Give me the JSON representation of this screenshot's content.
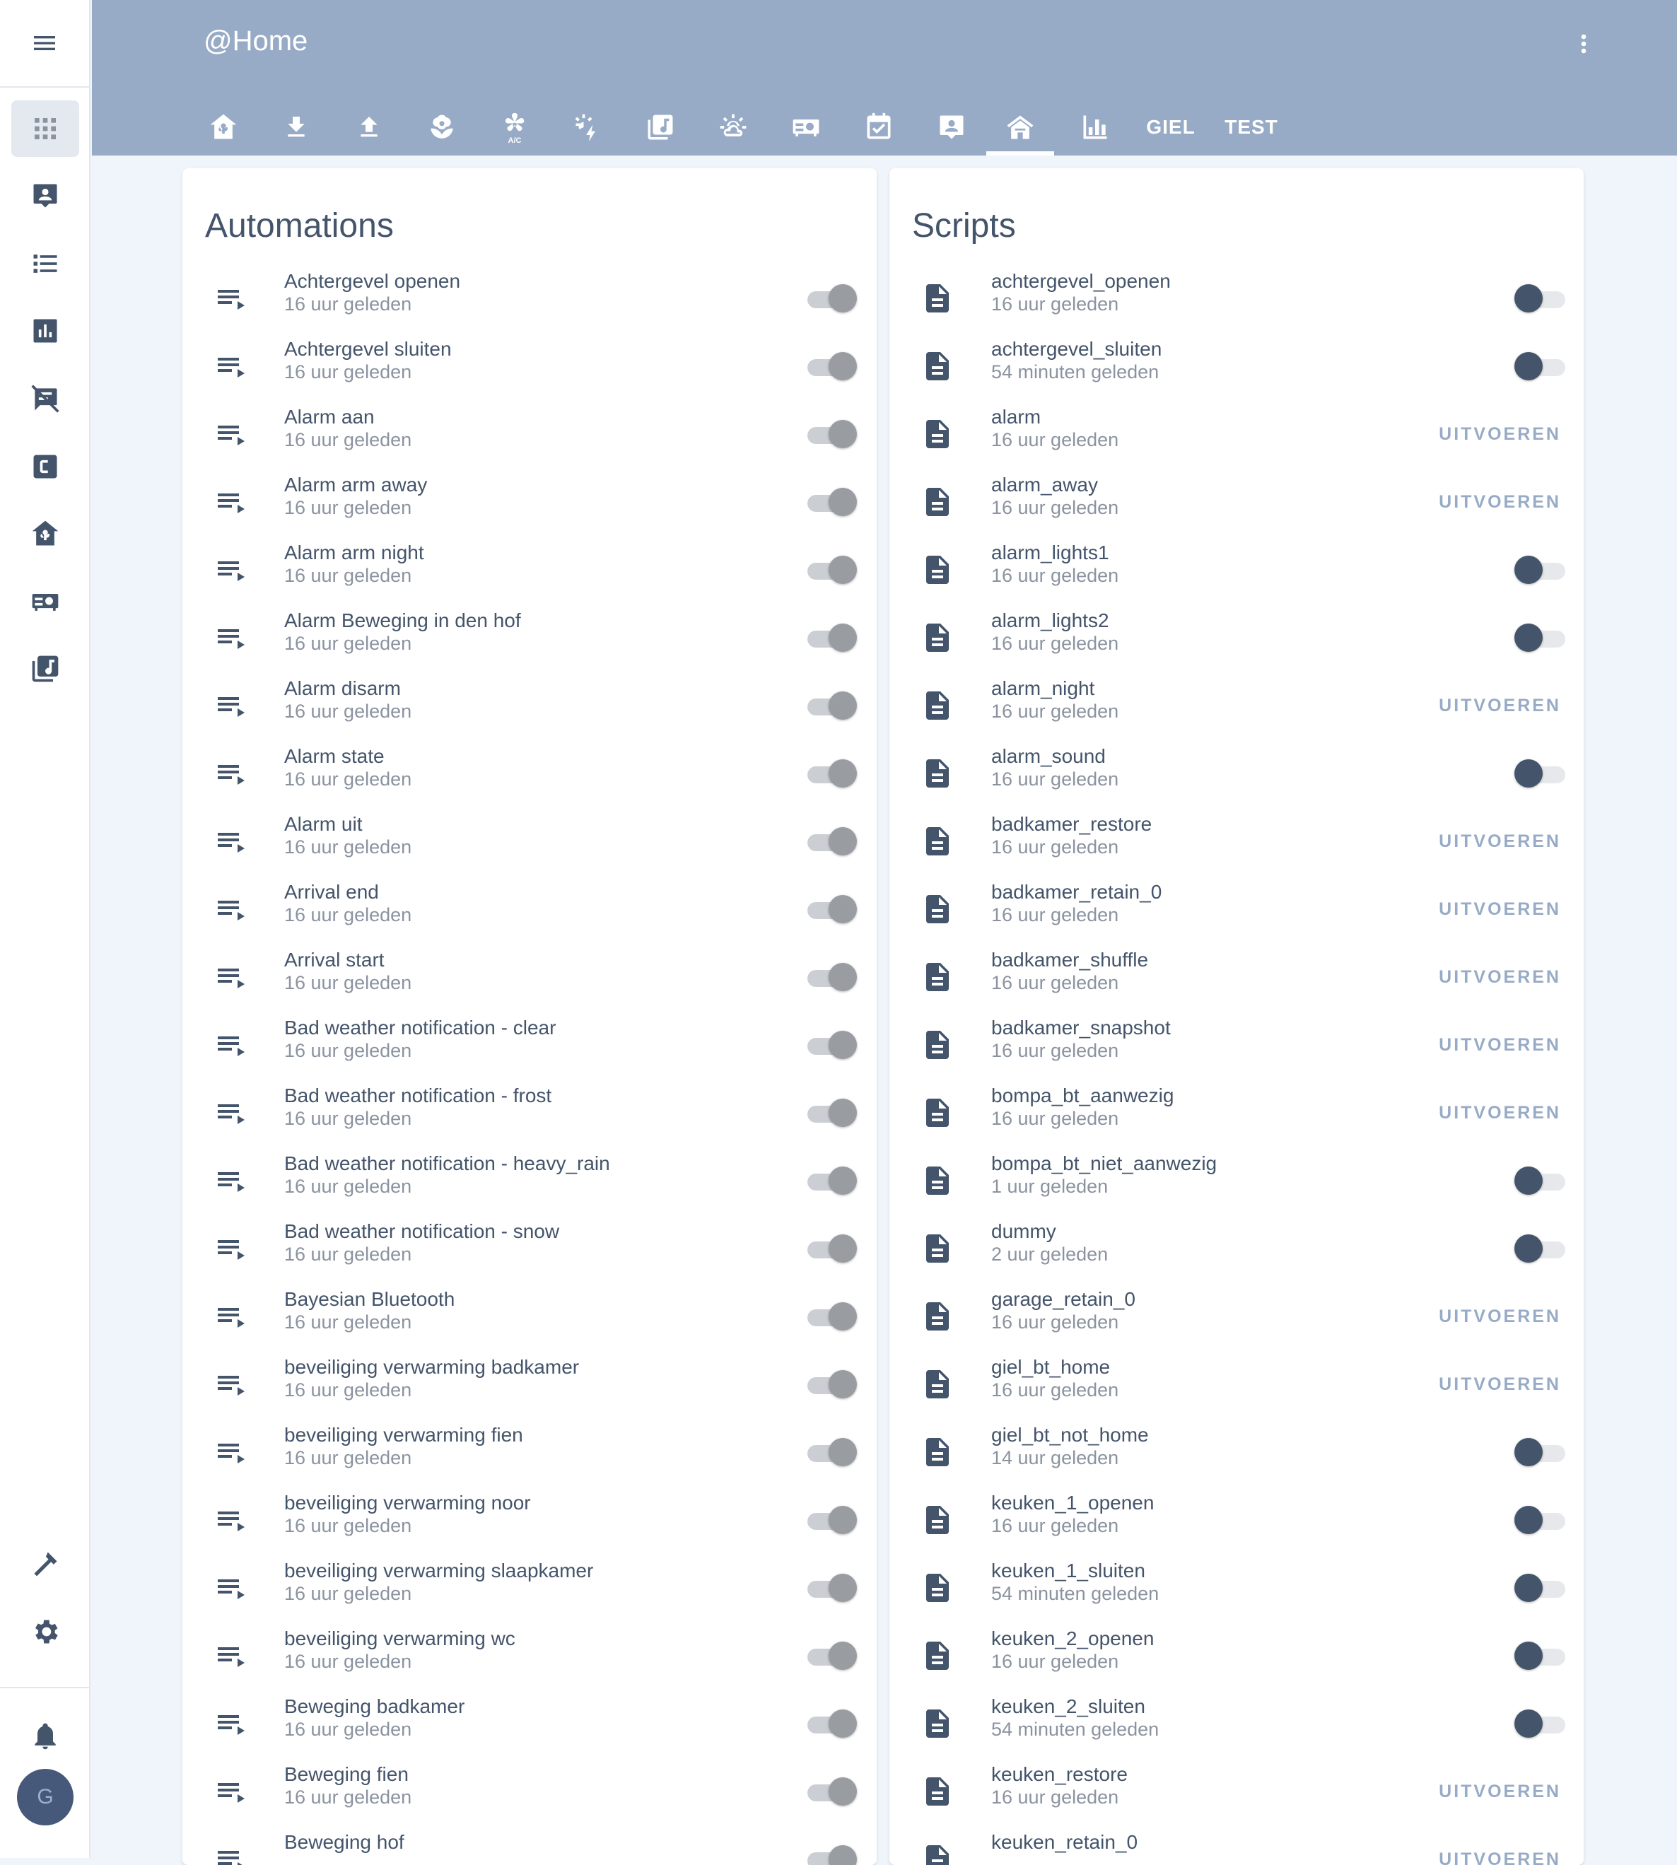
{
  "app": {
    "title": "@Home"
  },
  "colors": {
    "header": "#98abc6",
    "text": "#44546a",
    "secondary": "#8b93a0",
    "accent": "#44546a",
    "sidebar_active": "#e4e8ef"
  },
  "sidebar": {
    "menu_icon": "menu-icon",
    "items": [
      {
        "icon": "grid-icon",
        "active": true
      },
      {
        "icon": "account-box-icon"
      },
      {
        "icon": "list-icon"
      },
      {
        "icon": "bar-chart-icon"
      },
      {
        "icon": "message-off-icon"
      },
      {
        "icon": "alpha-c-box-icon"
      },
      {
        "icon": "home-flower-icon"
      },
      {
        "icon": "projector-icon"
      },
      {
        "icon": "music-library-icon"
      }
    ],
    "bottom": [
      {
        "icon": "hammer-icon"
      },
      {
        "icon": "settings-icon"
      }
    ],
    "notifications_icon": "bell-icon",
    "avatar": "G"
  },
  "tabs": [
    {
      "icon": "home-flower-icon"
    },
    {
      "icon": "download-icon"
    },
    {
      "icon": "upload-icon"
    },
    {
      "icon": "flower-icon"
    },
    {
      "icon": "air-conditioner-icon"
    },
    {
      "icon": "flash-icon"
    },
    {
      "icon": "music-library-icon"
    },
    {
      "icon": "weather-icon"
    },
    {
      "icon": "projector-icon"
    },
    {
      "icon": "calendar-check-icon"
    },
    {
      "icon": "account-box-icon"
    },
    {
      "icon": "home-icon",
      "active": true
    },
    {
      "icon": "bar-chart-icon"
    },
    {
      "label": "GIEL"
    },
    {
      "label": "TEST"
    }
  ],
  "automations": {
    "title": "Automations",
    "items": [
      {
        "name": "Achtergevel openen",
        "time": "16 uur geleden"
      },
      {
        "name": "Achtergevel sluiten",
        "time": "16 uur geleden"
      },
      {
        "name": "Alarm aan",
        "time": "16 uur geleden"
      },
      {
        "name": "Alarm arm away",
        "time": "16 uur geleden"
      },
      {
        "name": "Alarm arm night",
        "time": "16 uur geleden"
      },
      {
        "name": "Alarm Beweging in den hof",
        "time": "16 uur geleden"
      },
      {
        "name": "Alarm disarm",
        "time": "16 uur geleden"
      },
      {
        "name": "Alarm state",
        "time": "16 uur geleden"
      },
      {
        "name": "Alarm uit",
        "time": "16 uur geleden"
      },
      {
        "name": "Arrival end",
        "time": "16 uur geleden"
      },
      {
        "name": "Arrival start",
        "time": "16 uur geleden"
      },
      {
        "name": "Bad weather notification - clear",
        "time": "16 uur geleden"
      },
      {
        "name": "Bad weather notification - frost",
        "time": "16 uur geleden"
      },
      {
        "name": "Bad weather notification - heavy_rain",
        "time": "16 uur geleden"
      },
      {
        "name": "Bad weather notification - snow",
        "time": "16 uur geleden"
      },
      {
        "name": "Bayesian Bluetooth",
        "time": "16 uur geleden"
      },
      {
        "name": "beveiliging verwarming badkamer",
        "time": "16 uur geleden"
      },
      {
        "name": "beveiliging verwarming fien",
        "time": "16 uur geleden"
      },
      {
        "name": "beveiliging verwarming noor",
        "time": "16 uur geleden"
      },
      {
        "name": "beveiliging verwarming slaapkamer",
        "time": "16 uur geleden"
      },
      {
        "name": "beveiliging verwarming wc",
        "time": "16 uur geleden"
      },
      {
        "name": "Beweging badkamer",
        "time": "16 uur geleden"
      },
      {
        "name": "Beweging fien",
        "time": "16 uur geleden"
      },
      {
        "name": "Beweging hof",
        "time": ""
      }
    ]
  },
  "scripts": {
    "title": "Scripts",
    "run_label": "UITVOEREN",
    "items": [
      {
        "name": "achtergevel_openen",
        "time": "16 uur geleden",
        "control": "toggle"
      },
      {
        "name": "achtergevel_sluiten",
        "time": "54 minuten geleden",
        "control": "toggle"
      },
      {
        "name": "alarm",
        "time": "16 uur geleden",
        "control": "run"
      },
      {
        "name": "alarm_away",
        "time": "16 uur geleden",
        "control": "run"
      },
      {
        "name": "alarm_lights1",
        "time": "16 uur geleden",
        "control": "toggle"
      },
      {
        "name": "alarm_lights2",
        "time": "16 uur geleden",
        "control": "toggle"
      },
      {
        "name": "alarm_night",
        "time": "16 uur geleden",
        "control": "run"
      },
      {
        "name": "alarm_sound",
        "time": "16 uur geleden",
        "control": "toggle"
      },
      {
        "name": "badkamer_restore",
        "time": "16 uur geleden",
        "control": "run"
      },
      {
        "name": "badkamer_retain_0",
        "time": "16 uur geleden",
        "control": "run"
      },
      {
        "name": "badkamer_shuffle",
        "time": "16 uur geleden",
        "control": "run"
      },
      {
        "name": "badkamer_snapshot",
        "time": "16 uur geleden",
        "control": "run"
      },
      {
        "name": "bompa_bt_aanwezig",
        "time": "16 uur geleden",
        "control": "run"
      },
      {
        "name": "bompa_bt_niet_aanwezig",
        "time": "1 uur geleden",
        "control": "toggle"
      },
      {
        "name": "dummy",
        "time": "2 uur geleden",
        "control": "toggle"
      },
      {
        "name": "garage_retain_0",
        "time": "16 uur geleden",
        "control": "run"
      },
      {
        "name": "giel_bt_home",
        "time": "16 uur geleden",
        "control": "run"
      },
      {
        "name": "giel_bt_not_home",
        "time": "14 uur geleden",
        "control": "toggle"
      },
      {
        "name": "keuken_1_openen",
        "time": "16 uur geleden",
        "control": "toggle"
      },
      {
        "name": "keuken_1_sluiten",
        "time": "54 minuten geleden",
        "control": "toggle"
      },
      {
        "name": "keuken_2_openen",
        "time": "16 uur geleden",
        "control": "toggle"
      },
      {
        "name": "keuken_2_sluiten",
        "time": "54 minuten geleden",
        "control": "toggle"
      },
      {
        "name": "keuken_restore",
        "time": "16 uur geleden",
        "control": "run"
      },
      {
        "name": "keuken_retain_0",
        "time": "",
        "control": "run"
      }
    ]
  }
}
